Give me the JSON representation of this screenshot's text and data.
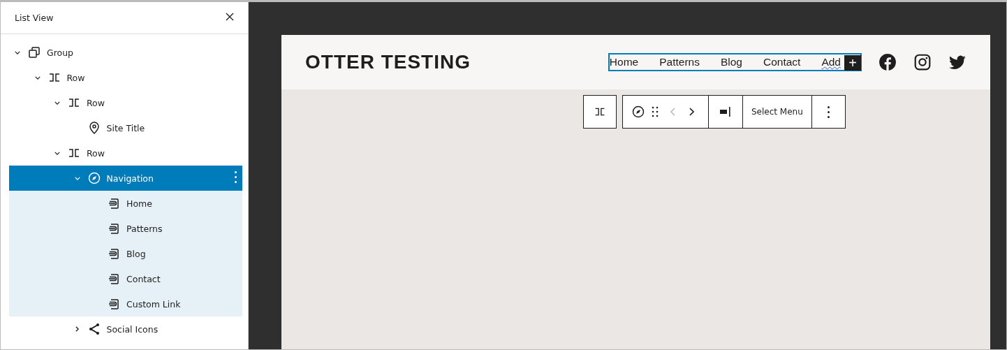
{
  "list_view": {
    "title": "List View",
    "items": [
      {
        "kind": "group",
        "label": "Group",
        "expanded": true,
        "selected": false,
        "children": [
          {
            "kind": "row",
            "label": "Row",
            "expanded": true,
            "selected": false,
            "children": [
              {
                "kind": "row",
                "label": "Row",
                "expanded": true,
                "selected": false,
                "children": [
                  {
                    "kind": "site-title",
                    "label": "Site Title",
                    "selected": false
                  }
                ]
              },
              {
                "kind": "row",
                "label": "Row",
                "expanded": true,
                "selected": false,
                "children": [
                  {
                    "kind": "navigation",
                    "label": "Navigation",
                    "expanded": true,
                    "selected": true,
                    "children": [
                      {
                        "kind": "link",
                        "label": "Home",
                        "selected": false
                      },
                      {
                        "kind": "link",
                        "label": "Patterns",
                        "selected": false
                      },
                      {
                        "kind": "link",
                        "label": "Blog",
                        "selected": false
                      },
                      {
                        "kind": "link",
                        "label": "Contact",
                        "selected": false
                      },
                      {
                        "kind": "link",
                        "label": "Custom Link",
                        "selected": false
                      }
                    ]
                  },
                  {
                    "kind": "social",
                    "label": "Social Icons",
                    "expanded": false,
                    "selected": false
                  }
                ]
              }
            ]
          }
        ]
      }
    ]
  },
  "site": {
    "title": "OTTER TESTING",
    "nav": [
      {
        "label": "Home",
        "misspelled": false
      },
      {
        "label": "Patterns",
        "misspelled": false
      },
      {
        "label": "Blog",
        "misspelled": false
      },
      {
        "label": "Contact",
        "misspelled": false
      },
      {
        "label": "Add",
        "misspelled": true
      }
    ],
    "add_button": "+",
    "social": [
      {
        "kind": "facebook"
      },
      {
        "kind": "instagram"
      },
      {
        "kind": "twitter"
      }
    ]
  },
  "toolbar": {
    "select_menu": "Select Menu",
    "prev_disabled": true
  }
}
